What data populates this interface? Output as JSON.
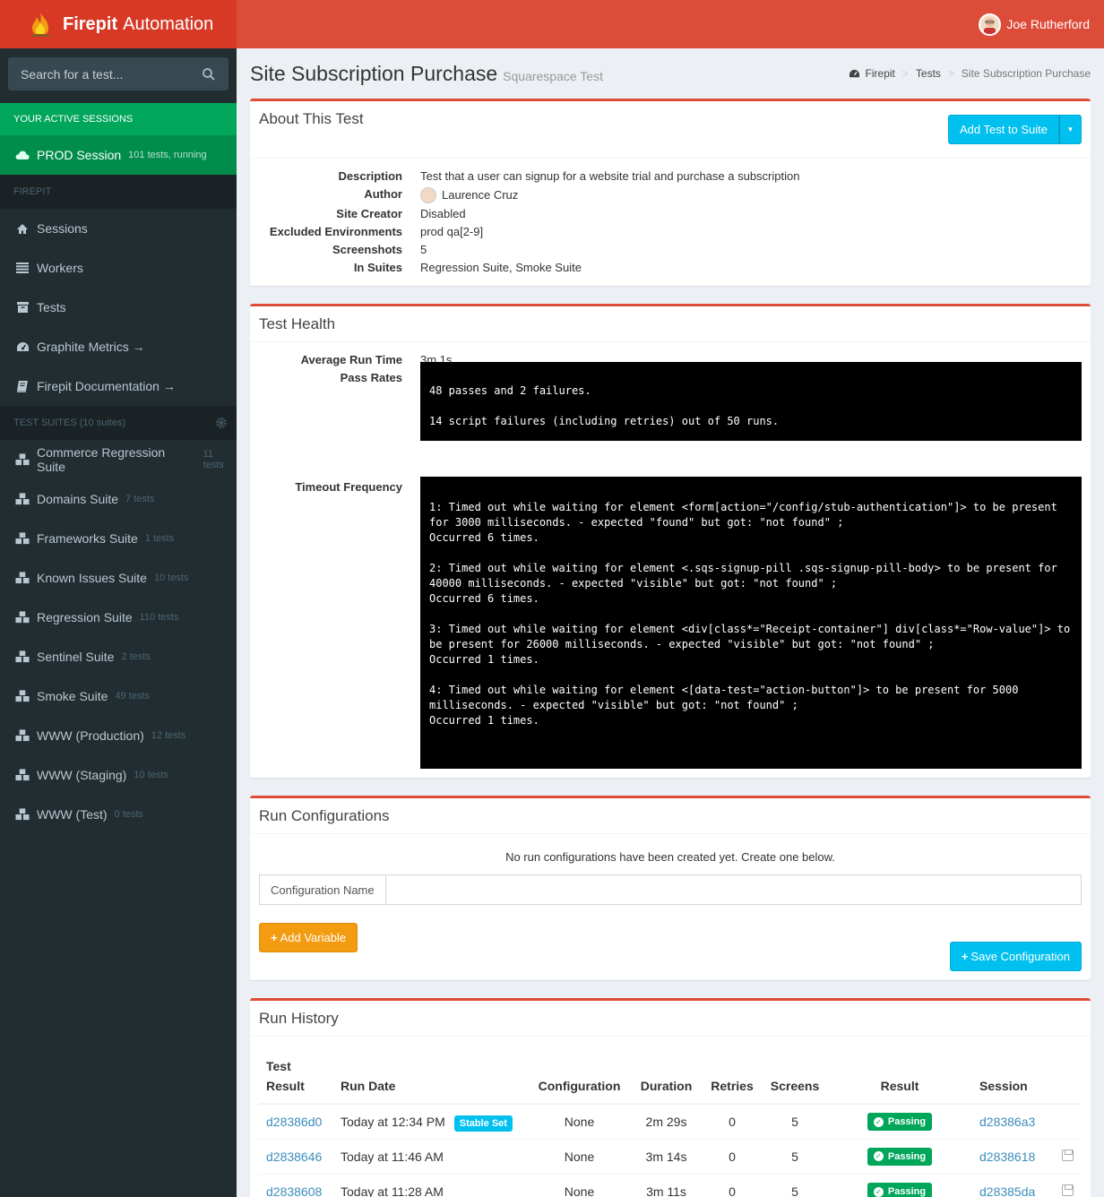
{
  "app": {
    "brand_bold": "Firepit",
    "brand_rest": "Automation",
    "user_name": "Joe Rutherford"
  },
  "sidebar": {
    "search_placeholder": "Search for a test...",
    "active_header": "YOUR ACTIVE SESSIONS",
    "active_session": {
      "label": "PROD Session",
      "meta": "101 tests, running"
    },
    "firepit_header": "FIREPIT",
    "nav": [
      {
        "label": "Sessions",
        "icon": "home-icon"
      },
      {
        "label": "Workers",
        "icon": "list-icon"
      },
      {
        "label": "Tests",
        "icon": "archive-icon"
      },
      {
        "label": "Graphite Metrics →",
        "icon": "dashboard-icon"
      },
      {
        "label": "Firepit Documentation →",
        "icon": "book-icon"
      }
    ],
    "suites_header": "TEST SUITES (10 suites)",
    "suites": [
      {
        "label": "Commerce Regression Suite",
        "count": "11 tests"
      },
      {
        "label": "Domains Suite",
        "count": "7 tests"
      },
      {
        "label": "Frameworks Suite",
        "count": "1 tests"
      },
      {
        "label": "Known Issues Suite",
        "count": "10 tests"
      },
      {
        "label": "Regression Suite",
        "count": "110 tests"
      },
      {
        "label": "Sentinel Suite",
        "count": "2 tests"
      },
      {
        "label": "Smoke Suite",
        "count": "49 tests"
      },
      {
        "label": "WWW (Production)",
        "count": "12 tests"
      },
      {
        "label": "WWW (Staging)",
        "count": "10 tests"
      },
      {
        "label": "WWW (Test)",
        "count": "0 tests"
      }
    ]
  },
  "header": {
    "title": "Site Subscription Purchase",
    "subtitle": "Squarespace Test",
    "breadcrumb": [
      "Firepit",
      "Tests",
      "Site Subscription Purchase"
    ]
  },
  "about": {
    "title": "About This Test",
    "add_button": "Add Test to Suite",
    "rows": [
      {
        "label": "Description",
        "value": "Test that a user can signup for a website trial and purchase a subscription"
      },
      {
        "label": "Author",
        "value": "Laurence Cruz"
      },
      {
        "label": "Site Creator",
        "value": "Disabled"
      },
      {
        "label": "Excluded Environments",
        "value": "prod qa[2-9]"
      },
      {
        "label": "Screenshots",
        "value": "5"
      },
      {
        "label": "In Suites",
        "value": "Regression Suite, Smoke Suite"
      }
    ]
  },
  "health": {
    "title": "Test Health",
    "avg_label": "Average Run Time",
    "avg_value": "3m 1s",
    "pass_label": "Pass Rates",
    "pass_text": "48 passes and 2 failures.\n\n14 script failures (including retries) out of 50 runs.",
    "timeout_label": "Timeout Frequency",
    "timeout_text": "1: Timed out while waiting for element <form[action=\"/config/stub-authentication\"]> to be present for 3000 milliseconds. - expected \"found\" but got: \"not found\" ;\nOccurred 6 times.\n\n2: Timed out while waiting for element <.sqs-signup-pill .sqs-signup-pill-body> to be present for 40000 milliseconds. - expected \"visible\" but got: \"not found\" ;\nOccurred 6 times.\n\n3: Timed out while waiting for element <div[class*=\"Receipt-container\"] div[class*=\"Row-value\"]> to be present for 26000 milliseconds. - expected \"visible\" but got: \"not found\" ;\nOccurred 1 times.\n\n4: Timed out while waiting for element <[data-test=\"action-button\"]> to be present for 5000 milliseconds. - expected \"visible\" but got: \"not found\" ;\nOccurred 1 times."
  },
  "run_config": {
    "title": "Run Configurations",
    "notice": "No run configurations have been created yet. Create one below.",
    "name_label": "Configuration Name",
    "add_variable": "Add Variable",
    "save": "Save Configuration"
  },
  "history": {
    "title": "Run History",
    "columns": {
      "test_result_1": "Test",
      "test_result_2": "Result",
      "run_date": "Run Date",
      "configuration": "Configuration",
      "duration": "Duration",
      "retries": "Retries",
      "screens": "Screens",
      "result": "Result",
      "session": "Session"
    },
    "stable_label": "Stable Set",
    "rows": [
      {
        "id": "d28386d0",
        "date": "Today at 12:34 PM",
        "config": "None",
        "duration": "2m 29s",
        "retries": "0",
        "screens": "5",
        "result": "Passing",
        "session": "d28386a3"
      },
      {
        "id": "d2838646",
        "date": "Today at 11:46 AM",
        "config": "None",
        "duration": "3m 14s",
        "retries": "0",
        "screens": "5",
        "result": "Passing",
        "session": "d2838618"
      },
      {
        "id": "d2838608",
        "date": "Today at 11:28 AM",
        "config": "None",
        "duration": "3m 11s",
        "retries": "0",
        "screens": "5",
        "result": "Passing",
        "session": "d28385da"
      }
    ]
  }
}
